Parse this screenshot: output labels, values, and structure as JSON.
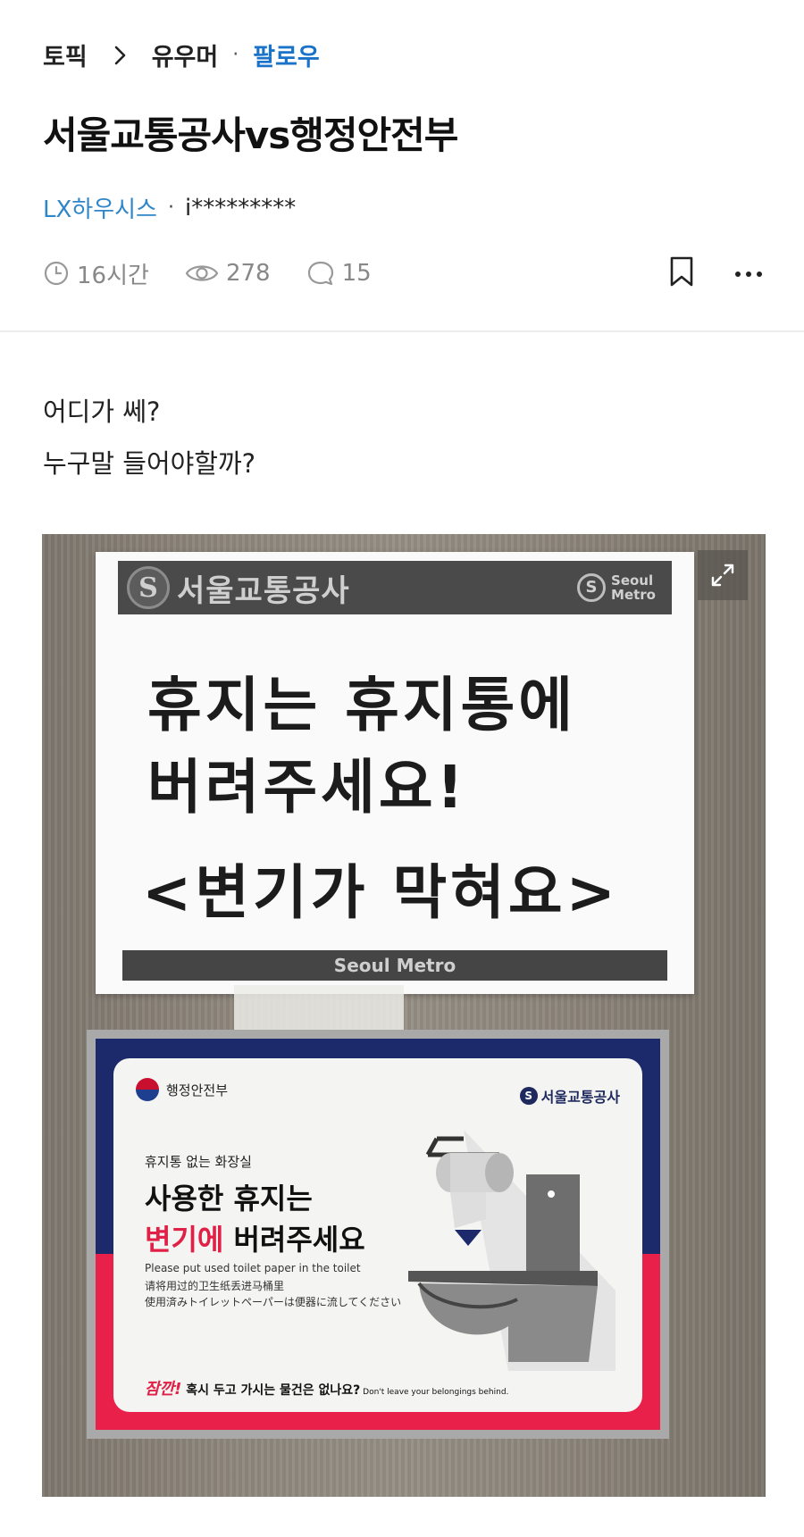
{
  "breadcrumb": {
    "topic": "토픽",
    "category": "유우머",
    "dot": "·",
    "follow": "팔로우"
  },
  "post": {
    "title": "서울교통공사vs행정안전부",
    "company": "LX하우시스",
    "author_dot": "·",
    "nickname": "i*********",
    "time": "16시간",
    "views": "278",
    "comments": "15",
    "body_lines": [
      "어디가 쎄?",
      "누구말 들어야할까?"
    ]
  },
  "icons": {
    "breadcrumb_chevron": "chevron-right-icon",
    "time": "clock-icon",
    "views": "eye-icon",
    "comments": "comment-icon",
    "bookmark": "bookmark-icon",
    "more": "more-icon",
    "expand": "expand-icon"
  },
  "photo": {
    "sign_top": {
      "org": "서울교통공사",
      "brand_small": [
        "Seoul",
        "Metro"
      ],
      "line1": "휴지는 휴지통에",
      "line2": "버려주세요!",
      "line3": "<변기가 막혀요>",
      "footer": "Seoul Metro"
    },
    "sign_bottom": {
      "ministry": "행정안전부",
      "org": "서울교통공사",
      "small": "휴지통 없는 화장실",
      "big1": "사용한 휴지는",
      "big2_red": "변기에",
      "big2_rest": " 버려주세요",
      "en": "Please put used toilet paper in the toilet",
      "zh": "请将用过的卫生纸丢进马桶里",
      "ja": "使用済みトイレットペーパーは便器に流してください",
      "foot_red": "잠깐!",
      "foot_text": " 혹시 두고 가시는 물건은 없나요?",
      "foot_en": " Don't leave your belongings behind."
    }
  },
  "colors": {
    "follow": "#1a73c9",
    "company": "#2f86c9",
    "meta": "#888888",
    "sign_navy": "#1c2a6b",
    "sign_red": "#e8204a"
  }
}
